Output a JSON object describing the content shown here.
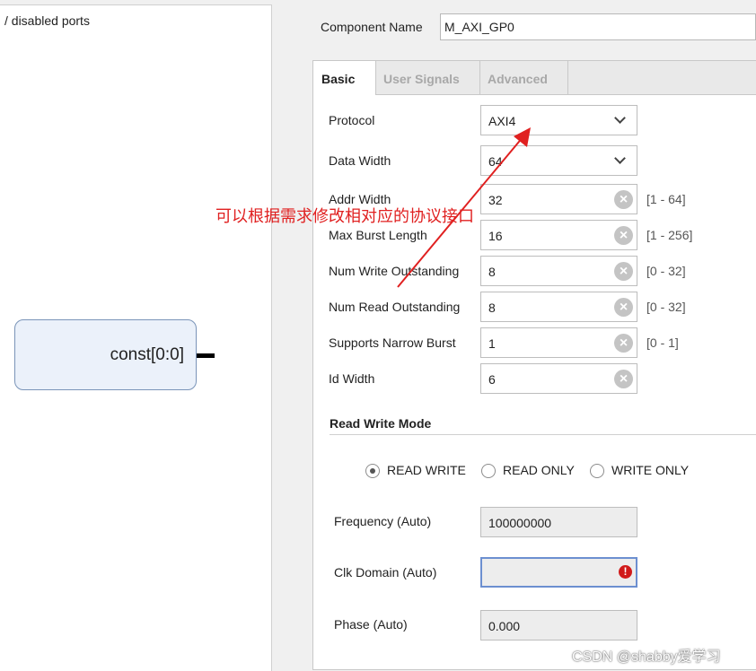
{
  "left_panel": {
    "caption": "/ disabled ports",
    "block_label": "const[0:0]"
  },
  "component": {
    "label": "Component Name",
    "value": "M_AXI_GP0"
  },
  "tabs": [
    {
      "label": "Basic",
      "active": true
    },
    {
      "label": "User Signals",
      "active": false
    },
    {
      "label": "Advanced",
      "active": false
    }
  ],
  "basic": {
    "protocol": {
      "label": "Protocol",
      "value": "AXI4"
    },
    "data_width": {
      "label": "Data Width",
      "value": "64"
    },
    "addr_width": {
      "label": "Addr Width",
      "value": "32",
      "range": "[1 - 64]"
    },
    "max_burst": {
      "label": "Max Burst Length",
      "value": "16",
      "range": "[1 - 256]"
    },
    "num_write": {
      "label": "Num Write Outstanding",
      "value": "8",
      "range": "[0 - 32]"
    },
    "num_read": {
      "label": "Num Read Outstanding",
      "value": "8",
      "range": "[0 - 32]"
    },
    "narrow_burst": {
      "label": "Supports Narrow Burst",
      "value": "1",
      "range": "[0 - 1]"
    },
    "id_width": {
      "label": "Id Width",
      "value": "6"
    }
  },
  "read_write_mode": {
    "title": "Read Write Mode",
    "options": [
      {
        "label": "READ WRITE",
        "selected": true
      },
      {
        "label": "READ ONLY",
        "selected": false
      },
      {
        "label": "WRITE ONLY",
        "selected": false
      }
    ]
  },
  "auto": {
    "frequency": {
      "label": "Frequency (Auto)",
      "value": "100000000"
    },
    "clk_domain": {
      "label": "Clk Domain (Auto)",
      "value": ""
    },
    "phase": {
      "label": "Phase (Auto)",
      "value": "0.000"
    }
  },
  "annotation": {
    "text": "可以根据需求修改相对应的协议接口",
    "color": "#e02020"
  },
  "watermark": "CSDN @shabby爱学习",
  "icons": {
    "clear": "clear-x-icon",
    "dropdown": "chevron-down-icon",
    "error": "error-icon"
  }
}
